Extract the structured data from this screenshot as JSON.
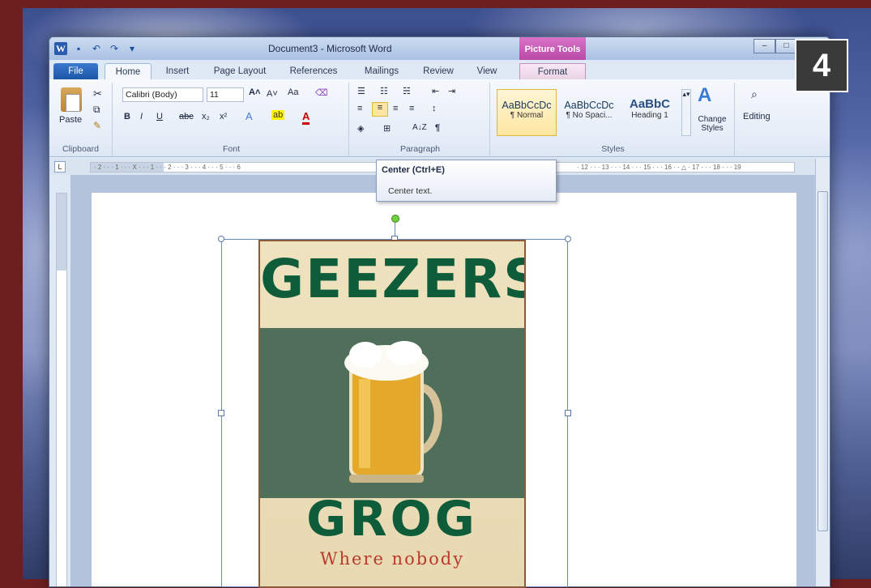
{
  "step_badge": "4",
  "window": {
    "title": "Document3 - Microsoft Word",
    "context_tab_group": "Picture Tools"
  },
  "tabs": [
    "File",
    "Home",
    "Insert",
    "Page Layout",
    "References",
    "Mailings",
    "Review",
    "View",
    "Format"
  ],
  "ribbon": {
    "clipboard": {
      "paste_label": "Paste",
      "group_label": "Clipboard"
    },
    "font": {
      "font_name": "Calibri (Body)",
      "font_size": "11",
      "group_label": "Font",
      "case_button": "Aa"
    },
    "paragraph": {
      "group_label": "Paragraph",
      "sort_label": "A↓Z",
      "pilcrow": "¶"
    },
    "styles": {
      "group_label": "Styles",
      "items": [
        {
          "sample": "AaBbCcDc",
          "name": "¶ Normal"
        },
        {
          "sample": "AaBbCcDc",
          "name": "¶ No Spaci..."
        },
        {
          "sample": "AaBbC",
          "name": "Heading 1"
        }
      ],
      "change_styles": "Change Styles"
    },
    "editing": {
      "label": "Editing"
    }
  },
  "tooltip": {
    "title": "Center (Ctrl+E)",
    "body": "Center text."
  },
  "ruler": {
    "corner": "L",
    "ticks": "· 2 · · · 1 · · · X · · · 1 · · · 2 · · · 3 · · · 4 · · · 5 · · · 6",
    "ticks_right": "· 12 · · · 13 · · · 14 · · · 15 · · · 16 · · △ · 17 · · · 18 · · · 19"
  },
  "image": {
    "line1": "GEEZERS",
    "line2": "GROG",
    "line3": "Where nobody"
  },
  "colors": {
    "frame": "#6d1f20",
    "sign_green": "#0f5c3b",
    "sign_red": "#b93a2a",
    "picture_tools": "#b84aa6"
  }
}
